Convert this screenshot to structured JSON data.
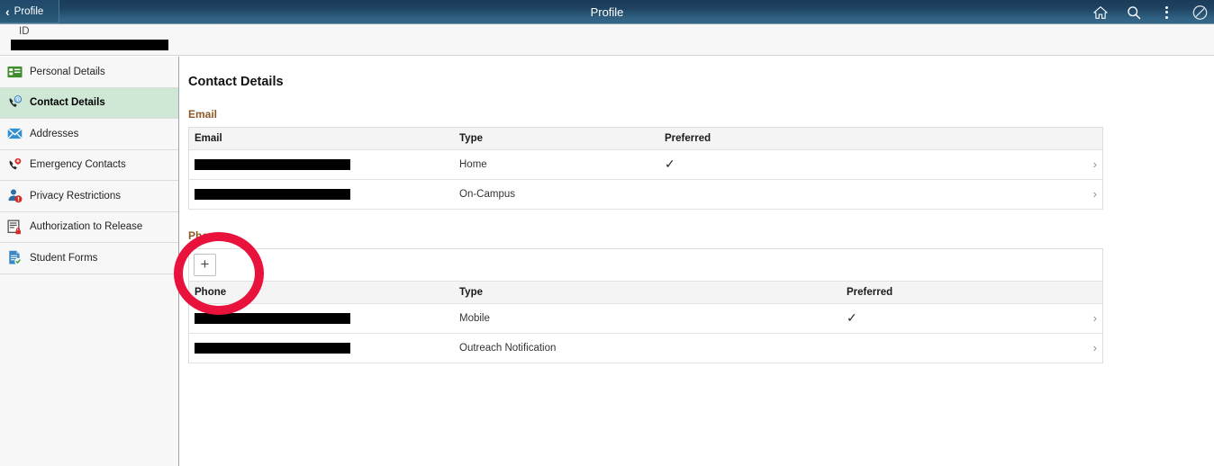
{
  "window": {
    "title": "Profile"
  },
  "topbar": {
    "back_label": "Profile",
    "title": "Profile",
    "icons": [
      {
        "name": "home-icon",
        "label": "Home"
      },
      {
        "name": "search-icon",
        "label": "Search"
      },
      {
        "name": "kebab-menu-icon",
        "label": "Actions"
      },
      {
        "name": "signout-icon",
        "label": "Sign Out"
      }
    ]
  },
  "id_strip": {
    "label": "ID",
    "value": "",
    "redacted": true
  },
  "sidebar": {
    "items": [
      {
        "label": "Personal Details",
        "icon": "id-card-icon",
        "active": false
      },
      {
        "label": "Contact Details",
        "icon": "phone-at-icon",
        "active": true
      },
      {
        "label": "Addresses",
        "icon": "envelope-icon",
        "active": false
      },
      {
        "label": "Emergency Contacts",
        "icon": "phone-alert-icon",
        "active": false
      },
      {
        "label": "Privacy Restrictions",
        "icon": "person-alert-icon",
        "active": false
      },
      {
        "label": "Authorization to Release",
        "icon": "form-lock-icon",
        "active": false
      },
      {
        "label": "Student Forms",
        "icon": "document-check-icon",
        "active": false
      }
    ]
  },
  "main": {
    "page_title": "Contact Details",
    "sections": [
      {
        "label": "Email",
        "columns": {
          "value": "Email",
          "type": "Type",
          "preferred": "Preferred"
        },
        "has_toolbar": false,
        "rows": [
          {
            "value": "",
            "redacted": true,
            "type": "Home",
            "preferred": true
          },
          {
            "value": "",
            "redacted": true,
            "type": "On-Campus",
            "preferred": false
          }
        ]
      },
      {
        "label": "Phone",
        "columns": {
          "value": "Phone",
          "type": "Type",
          "preferred": "Preferred"
        },
        "has_toolbar": true,
        "add_button_label": "+",
        "rows": [
          {
            "value": "",
            "redacted": true,
            "type": "Mobile",
            "preferred": true
          },
          {
            "value": "",
            "redacted": true,
            "type": "Outreach Notification",
            "preferred": false
          }
        ]
      }
    ],
    "check_glyph": "✓",
    "arrow_glyph": "›"
  },
  "annotation": {
    "shape": "circle",
    "color": "#e8123c",
    "targets": "add-phone-button"
  },
  "colors": {
    "header_dark": "#1b3c58",
    "header_light": "#37688b",
    "sidebar_bg": "#f7f7f7",
    "active_row": "#cfe8d6",
    "section_label": "#8d5a25",
    "annotation": "#e8123c"
  }
}
